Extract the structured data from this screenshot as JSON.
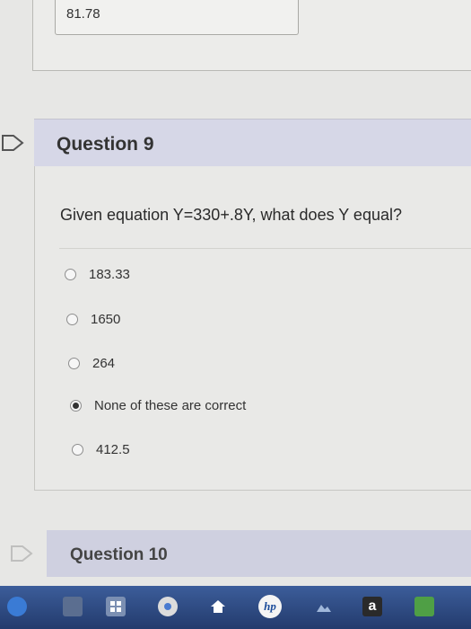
{
  "previous_question": {
    "answer_value": "81.78"
  },
  "question_9": {
    "title": "Question 9",
    "prompt": "Given equation Y=330+.8Y, what does Y equal?",
    "options": [
      {
        "label": "183.33",
        "selected": false
      },
      {
        "label": "1650",
        "selected": false
      },
      {
        "label": "264",
        "selected": false
      },
      {
        "label": "None of these are correct",
        "selected": true
      },
      {
        "label": "412.5",
        "selected": false
      }
    ]
  },
  "question_10": {
    "title": "Question 10"
  },
  "taskbar": {
    "icons": [
      "windows-icon",
      "file-explorer-icon",
      "store-icon",
      "chrome-icon",
      "home-icon",
      "hp-icon",
      "photos-icon",
      "amazon-icon",
      "app-icon"
    ],
    "amazon_glyph": "a",
    "hp_glyph": "hp"
  },
  "colors": {
    "question_header_bg": "#d6d7e7",
    "taskbar_bg": "#2b467c"
  }
}
